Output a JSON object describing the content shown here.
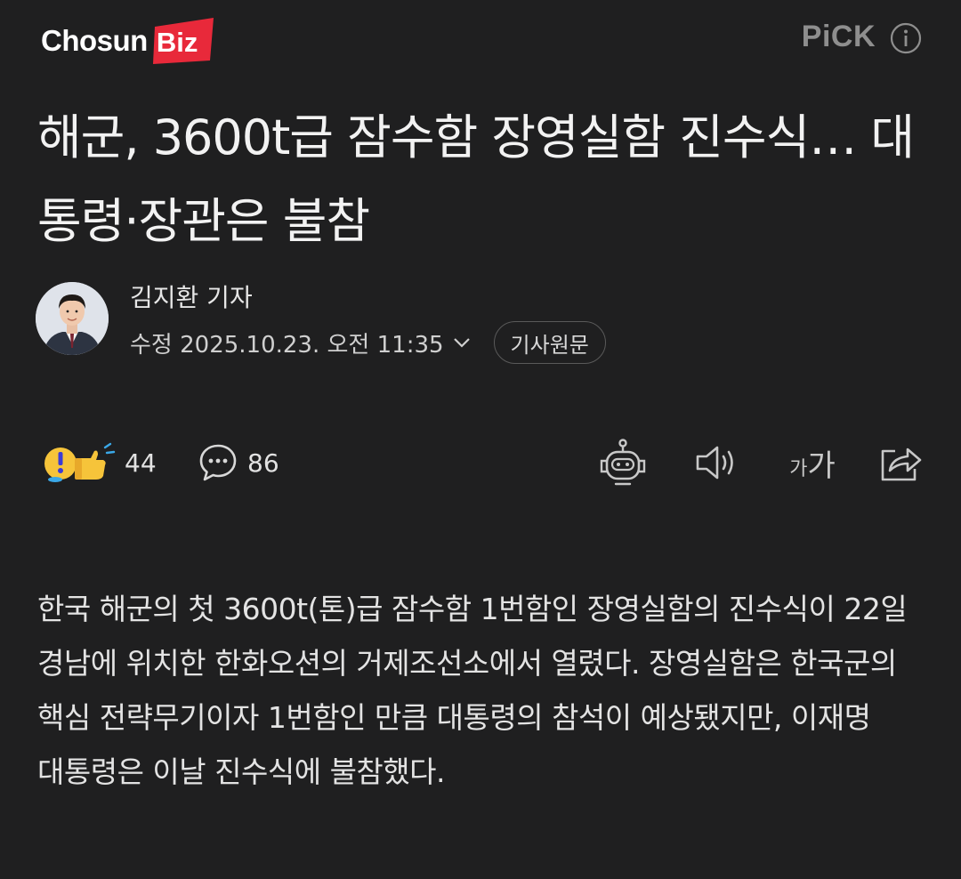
{
  "header": {
    "logo_main": "Chosun",
    "logo_sub": "Biz",
    "pick_label": "PiCK",
    "brand_color": "#e8293a"
  },
  "article": {
    "title": "해군, 3600t급 잠수함 장영실함 진수식… 대통령·장관은 불참",
    "reporter": "김지환 기자",
    "date": "수정 2025.10.23. 오전 11:35",
    "origin_button": "기사원문",
    "body": "한국 해군의 첫 3600t(톤)급 잠수함 1번함인 장영실함의 진수식이 22일 경남에 위치한 한화오션의 거제조선소에서 열렸다. 장영실함은 한국군의 핵심 전략무기이자 1번함인 만큼 대통령의 참석이 예상됐지만, 이재명 대통령은 이날 진수식에 불참했다."
  },
  "actions": {
    "reaction_count": "44",
    "comment_count": "86",
    "font_small": "가",
    "font_large": "가"
  },
  "icons": {
    "reaction": "reaction-emoji-icon",
    "comment": "comment-bubble-icon",
    "summary": "robot-icon",
    "listen": "speaker-icon",
    "share": "share-icon",
    "info": "info-icon",
    "expand": "chevron-down-icon"
  }
}
